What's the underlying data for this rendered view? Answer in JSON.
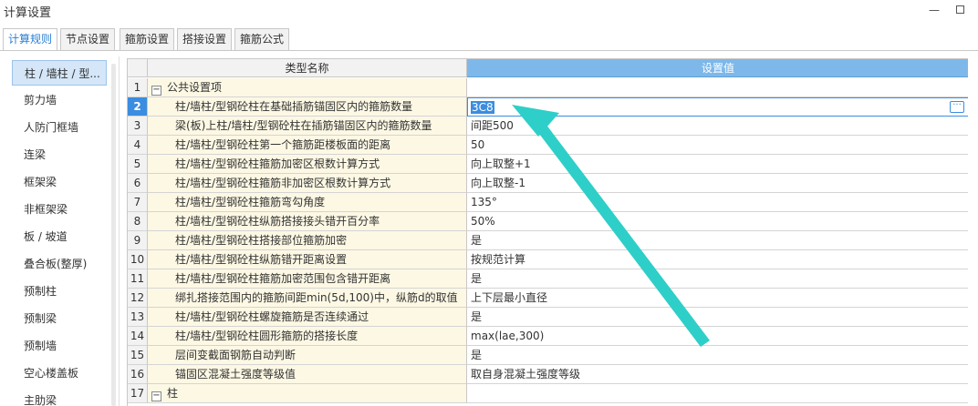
{
  "window": {
    "title": "计算设置",
    "minimize_icon": "minimize-icon",
    "maximize_icon": "maximize-icon"
  },
  "tabs": [
    {
      "label": "计算规则",
      "active": true
    },
    {
      "label": "节点设置"
    },
    {
      "label": "箍筋设置"
    },
    {
      "label": "搭接设置"
    },
    {
      "label": "箍筋公式"
    }
  ],
  "sidebar": {
    "items": [
      {
        "label": "柱 / 墙柱 / 型...",
        "selected": true
      },
      {
        "label": "剪力墙"
      },
      {
        "label": "人防门框墙"
      },
      {
        "label": "连梁"
      },
      {
        "label": "框架梁"
      },
      {
        "label": "非框架梁"
      },
      {
        "label": "板 / 坡道"
      },
      {
        "label": "叠合板(整厚)"
      },
      {
        "label": "预制柱"
      },
      {
        "label": "预制梁"
      },
      {
        "label": "预制墙"
      },
      {
        "label": "空心楼盖板"
      },
      {
        "label": "主肋梁"
      }
    ]
  },
  "table": {
    "header": {
      "name": "类型名称",
      "value": "设置值"
    },
    "rows": [
      {
        "num": "1",
        "name": "公共设置项",
        "value": "",
        "group": true,
        "expander": "−"
      },
      {
        "num": "2",
        "name": "柱/墙柱/型钢砼柱在基础插筋锚固区内的箍筋数量",
        "value": "3C8",
        "selected": true
      },
      {
        "num": "3",
        "name": "梁(板)上柱/墙柱/型钢砼柱在插筋锚固区内的箍筋数量",
        "value": "间距500"
      },
      {
        "num": "4",
        "name": "柱/墙柱/型钢砼柱第一个箍筋距楼板面的距离",
        "value": "50"
      },
      {
        "num": "5",
        "name": "柱/墙柱/型钢砼柱箍筋加密区根数计算方式",
        "value": "向上取整+1"
      },
      {
        "num": "6",
        "name": "柱/墙柱/型钢砼柱箍筋非加密区根数计算方式",
        "value": "向上取整-1"
      },
      {
        "num": "7",
        "name": "柱/墙柱/型钢砼柱箍筋弯勾角度",
        "value": "135°"
      },
      {
        "num": "8",
        "name": "柱/墙柱/型钢砼柱纵筋搭接接头错开百分率",
        "value": "50%"
      },
      {
        "num": "9",
        "name": "柱/墙柱/型钢砼柱搭接部位箍筋加密",
        "value": "是"
      },
      {
        "num": "10",
        "name": "柱/墙柱/型钢砼柱纵筋错开距离设置",
        "value": "按规范计算"
      },
      {
        "num": "11",
        "name": "柱/墙柱/型钢砼柱箍筋加密范围包含错开距离",
        "value": "是"
      },
      {
        "num": "12",
        "name": "绑扎搭接范围内的箍筋间距min(5d,100)中，纵筋d的取值",
        "value": "上下层最小直径"
      },
      {
        "num": "13",
        "name": "柱/墙柱/型钢砼柱螺旋箍筋是否连续通过",
        "value": "是"
      },
      {
        "num": "14",
        "name": "柱/墙柱/型钢砼柱圆形箍筋的搭接长度",
        "value": "max(lae,300)"
      },
      {
        "num": "15",
        "name": "层间变截面钢筋自动判断",
        "value": "是"
      },
      {
        "num": "16",
        "name": "锚固区混凝土强度等级值",
        "value": "取自身混凝土强度等级"
      },
      {
        "num": "17",
        "name": "柱",
        "value": "",
        "group": true,
        "expander": "−"
      }
    ],
    "ellipsis_button": "···"
  },
  "colors": {
    "accent": "#3b8de0",
    "header_value_bg": "#7eb8ea",
    "name_col_bg": "#fdf8e4",
    "arrow": "#2ecfc8"
  }
}
